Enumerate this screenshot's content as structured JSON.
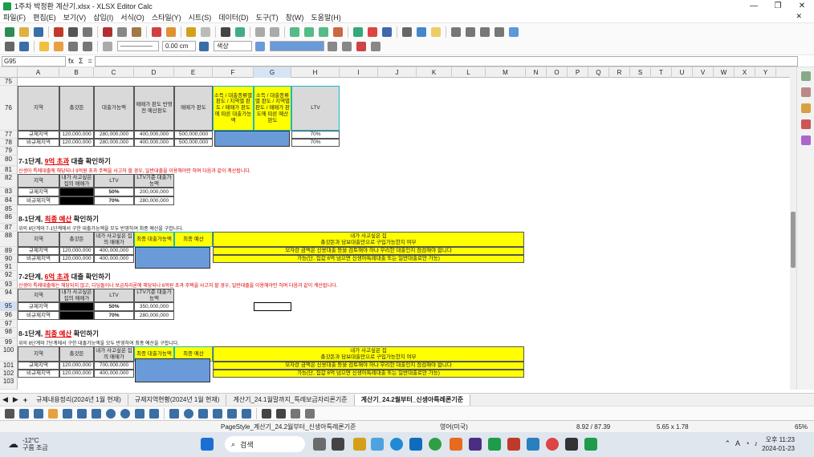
{
  "window": {
    "title": "1주차 박정환 계산기.xlsx - XLSX Editor Calc",
    "min": "—",
    "max": "❐",
    "close": "✕"
  },
  "menu": [
    "파일(F)",
    "편집(E)",
    "보기(V)",
    "삽입(I)",
    "서식(O)",
    "스타일(Y)",
    "시트(S)",
    "데이터(D)",
    "도구(T)",
    "창(W)",
    "도움말(H)"
  ],
  "menu_close": "✕",
  "toolbar2": {
    "line_width": "0.00 cm",
    "line_color": "색상"
  },
  "formula_bar": {
    "name_box": "G95",
    "fx": "fx",
    "sum": "Σ",
    "eq": "="
  },
  "columns": [
    "A",
    "B",
    "C",
    "D",
    "E",
    "F",
    "G",
    "H",
    "I",
    "J",
    "K",
    "L",
    "M",
    "N",
    "O",
    "P",
    "Q",
    "R",
    "S",
    "T",
    "U",
    "V",
    "W",
    "X",
    "Y"
  ],
  "rows": [
    "75",
    "76",
    "77",
    "78",
    "79",
    "80",
    "81",
    "82",
    "83",
    "84",
    "85",
    "86",
    "87",
    "88",
    "89",
    "90",
    "91",
    "92",
    "93",
    "94",
    "95",
    "96",
    "97",
    "98",
    "99",
    "100",
    "101",
    "102",
    "103"
  ],
  "table1": {
    "headers": [
      "지역",
      "총갓돈",
      "대출가능액",
      "매매가 판도 반영전 예산판도",
      "매매가 판도",
      "소득 / 대출종류별 판도 / 지역별 판도 / 매매가 판도에 따른 대출가능액",
      "소득 / 대출종류별 판도 / 지역별 판도 / 매매가 판도에 따른 예산판도",
      "LTV"
    ],
    "rows": [
      [
        "규제지역",
        "120,000,000",
        "280,000,000",
        "400,000,000",
        "500,000,000",
        "",
        "",
        "70%"
      ],
      [
        "비규제지역",
        "120,000,000",
        "280,000,000",
        "400,000,000",
        "500,000,000",
        "",
        "",
        "70%"
      ]
    ]
  },
  "sec71": {
    "heading_a": "7-1단계, ",
    "heading_r1": "9억 초과",
    "heading_b": " 대출 확인하기",
    "note": "신생아 특례대출에 해당되나 9억원 초과 주택을 사고자 할 경우, 일반대출을 이용해야만 하며 다음과 같이 계산됩니다.",
    "headers": [
      "지역",
      "내가 사고싶은 집의 매매가",
      "LTV",
      "LTV기준 대출가능액"
    ],
    "rows": [
      [
        "규제지역",
        "",
        "50%",
        "200,000,000"
      ],
      [
        "비규제지역",
        "",
        "70%",
        "280,000,000"
      ]
    ]
  },
  "sec81a": {
    "heading_a": "8-1단계, ",
    "heading_r1": "최종 예산",
    "heading_b": " 확인하기",
    "note": "위의 6단계와 7-1단계에서 구한 대출가능액을 모두 반영하여 최종 예산을 구합니다.",
    "headers": [
      "지역",
      "총갓돈",
      "내가 사고싶은 집의 매매가",
      "최종 대출가능액",
      "최종 예산"
    ],
    "rows": [
      [
        "규제지역",
        "120,000,000",
        "400,000,000"
      ],
      [
        "비규제지역",
        "120,000,000",
        "400,000,000"
      ]
    ],
    "info_title": "내가 사고싶은 집\n총갓돈과 담보대출만으로 구입가능한지 여부",
    "info_1": "모자란 금액은 신용대출 등을 검토해야 하나 무리한 대출인지 점검해야 합니다",
    "info_2": "가능(단, 집값 6억 넘으면 신생아특례대출 또는 일반대출로만 가능)"
  },
  "sec72": {
    "heading_a": "7-2단계, ",
    "heading_r1": "6억 초과",
    "heading_b": " 대출 확인하기",
    "note": "신생아 특례대출에는 해당되지 않고, 디딤돌이나 보금자리론에 해당되나 6억원 초과 주택을 사고자 할 경우, 일반대출을 이용해야만 하며 다음과 같이 계산됩니다.",
    "headers": [
      "지역",
      "내가 사고싶은 집의 매매가",
      "LTV",
      "LTV기준 대출가능액"
    ],
    "rows": [
      [
        "규제지역",
        "",
        "50%",
        "350,000,000"
      ],
      [
        "비규제지역",
        "",
        "70%",
        "280,000,000"
      ]
    ]
  },
  "sec81b": {
    "heading_a": "8-1단계, ",
    "heading_r1": "최종 예산",
    "heading_b": " 확인하기",
    "note": "위의 6단계와 7단계에서 구한 대출가능액을 모두 반영하여 최종 예산을 구합니다.",
    "headers": [
      "지역",
      "총갓돈",
      "내가 사고싶은 집의 매매가",
      "최종 대출가능액",
      "최종 예산"
    ],
    "rows": [
      [
        "규제지역",
        "120,000,000",
        "700,000,000"
      ],
      [
        "비규제지역",
        "120,000,000",
        "400,000,000"
      ]
    ],
    "info_title": "내가 사고싶은 집\n총갓돈과 담보대출만으로 구입가능한지 여부",
    "info_1": "모자란 금액은 신용대출 등을 검토해야 하나 무리한 대출인지 점검해야 합니다",
    "info_2": "가능(단, 집값 6억 넘으면 신생아특례대출 또는 일반대출로만 가능)"
  },
  "sheet_tabs": [
    "규제내용정리(2024년 1월 현재)",
    "규제지역현황(2024년 1월 현재)",
    "계산기_24.1월말까지_특례보금자리론기준",
    "계산기_24.2월부터_신생아특례론기준"
  ],
  "tab_add": "+",
  "status": {
    "page_style": "PageStyle_계산기_24.2월부터_신생아특례론기준",
    "language": "영어(미국)",
    "position": "8.92 / 87.39",
    "size": "5.65 x 1.78",
    "zoom": "65%"
  },
  "taskbar": {
    "temp": "-12°C",
    "weather": "구름 조금",
    "search": "검색",
    "time": "오후 11:23",
    "date": "2024-01-23",
    "lang": "A"
  },
  "colors": {
    "yellow": "#ffff00",
    "blue": "#6a9bd8",
    "red": "#e00000",
    "gray": "#d9d9d9"
  }
}
